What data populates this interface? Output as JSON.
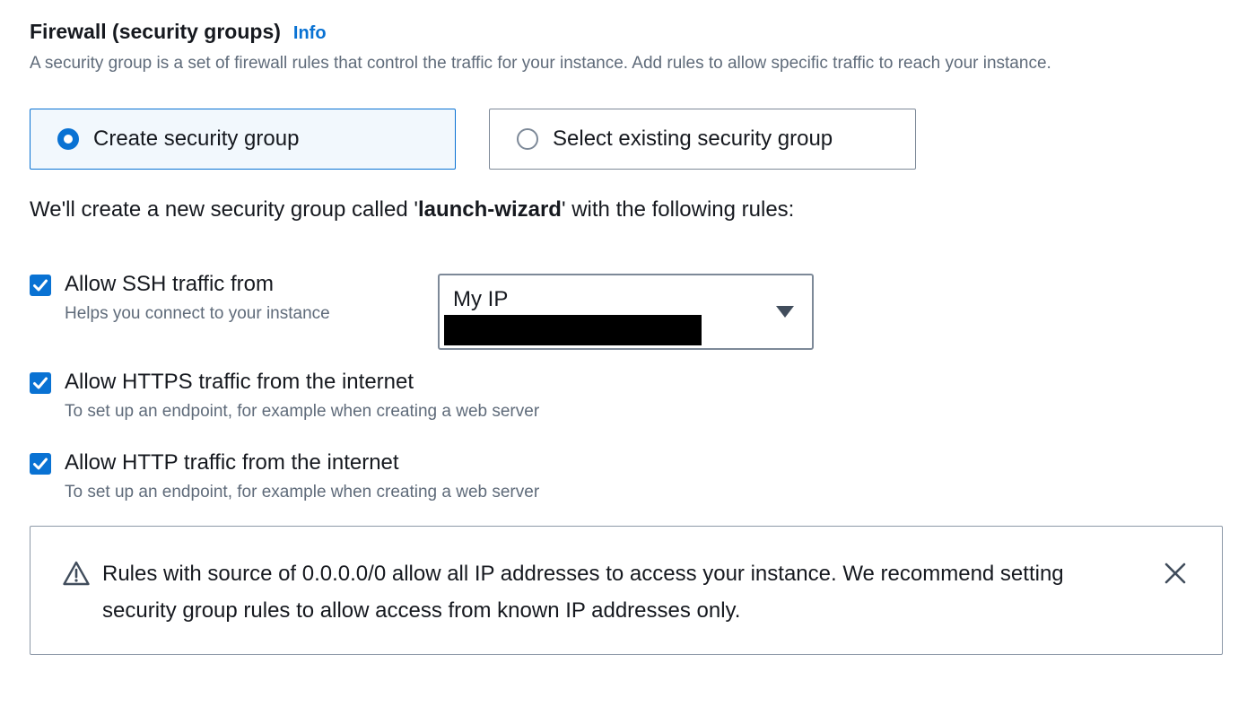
{
  "firewall": {
    "title": "Firewall (security groups)",
    "info_link": "Info",
    "description": "A security group is a set of firewall rules that control the traffic for your instance. Add rules to allow specific traffic to reach your instance."
  },
  "group_choice": {
    "selected": "create",
    "options": [
      {
        "id": "create",
        "label": "Create security group"
      },
      {
        "id": "existing",
        "label": "Select existing security group"
      }
    ]
  },
  "intro": {
    "prefix": "We'll create a new security group called '",
    "group_name": "launch-wizard",
    "suffix": "' with the following rules:"
  },
  "rules": [
    {
      "label": "Allow SSH traffic from",
      "description": "Helps you connect to your instance",
      "checked": true
    },
    {
      "label": "Allow HTTPS traffic from the internet",
      "description": "To set up an endpoint, for example when creating a web server",
      "checked": true
    },
    {
      "label": "Allow HTTP traffic from the internet",
      "description": "To set up an endpoint, for example when creating a web server",
      "checked": true
    }
  ],
  "ssh_source": {
    "value": "My IP",
    "icon": "caret-down-icon"
  },
  "alert": {
    "type": "warning",
    "icon": "warning-icon",
    "text": "Rules with source of 0.0.0.0/0 allow all IP addresses to access your instance. We recommend setting security group rules to allow access from known IP addresses only.",
    "close_icon": "close-icon"
  },
  "colors": {
    "accent": "#0972d3",
    "text": "#16191f",
    "secondary_text": "#5f6b7a",
    "selected_tile_bg": "#f2f8fd",
    "border": "#7d8998"
  }
}
